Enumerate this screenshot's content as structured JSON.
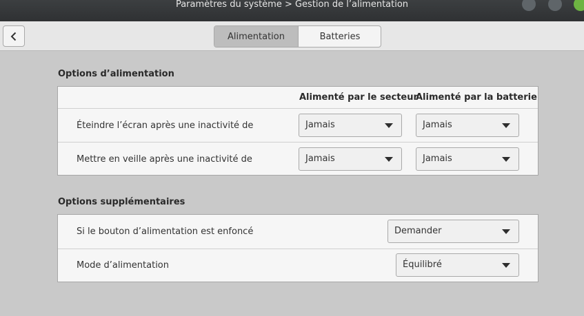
{
  "window": {
    "title": "Paramètres du système > Gestion de l’alimentation"
  },
  "header": {
    "back_icon": "chevron-left-icon",
    "tabs": [
      {
        "label": "Alimentation",
        "active": true
      },
      {
        "label": "Batteries",
        "active": false
      }
    ]
  },
  "power_options": {
    "title": "Options d’alimentation",
    "col_ac": "Alimenté par le secteur",
    "col_battery": "Alimenté par la batterie",
    "rows": [
      {
        "label": "Éteindre l’écran après une inactivité de",
        "ac_value": "Jamais",
        "battery_value": "Jamais"
      },
      {
        "label": "Mettre en veille après une inactivité de",
        "ac_value": "Jamais",
        "battery_value": "Jamais"
      }
    ]
  },
  "extra_options": {
    "title": "Options supplémentaires",
    "rows": [
      {
        "label": "Si le bouton d’alimentation est enfoncé",
        "value": "Demander"
      },
      {
        "label": "Mode d’alimentation",
        "value": "Équilibré"
      }
    ]
  },
  "colors": {
    "background": "#c9c9c9",
    "titlebar": "#2f3133",
    "close_button": "#6db442"
  }
}
